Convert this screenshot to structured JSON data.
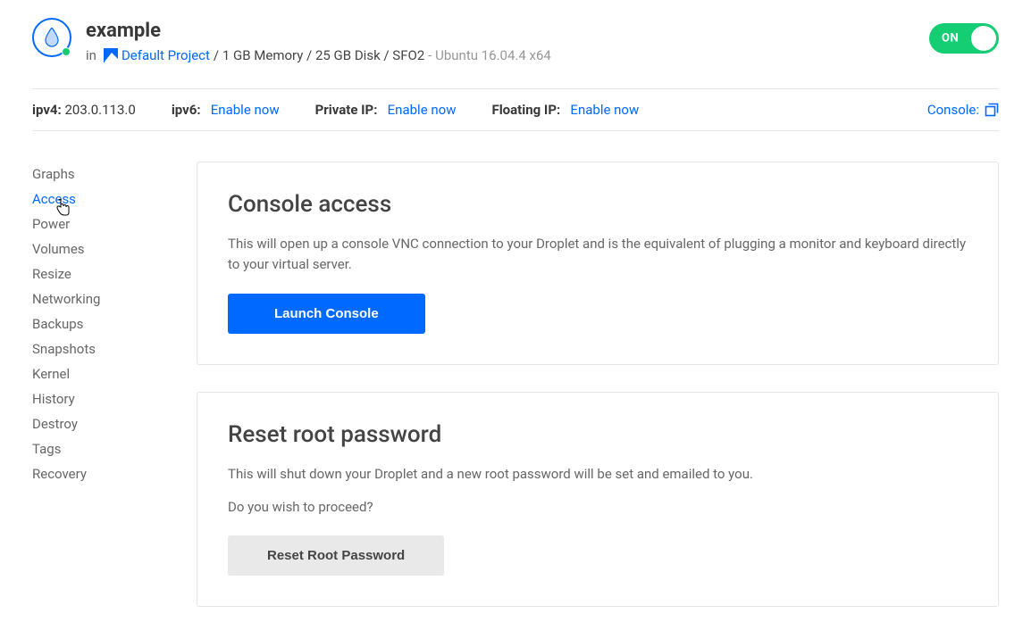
{
  "header": {
    "title": "example",
    "in_text": "in",
    "project_link": "Default Project",
    "specs": " / 1 GB Memory / 25 GB Disk / SFO2",
    "os": " - Ubuntu 16.04.4 x64",
    "toggle_label": "ON"
  },
  "infobar": {
    "ipv4_label": "ipv4:",
    "ipv4_value": "203.0.113.0",
    "ipv6_label": "ipv6:",
    "ipv6_link": "Enable now",
    "private_label": "Private IP:",
    "private_link": "Enable now",
    "floating_label": "Floating IP:",
    "floating_link": "Enable now",
    "console_label": "Console:"
  },
  "sidebar": {
    "items": [
      "Graphs",
      "Access",
      "Power",
      "Volumes",
      "Resize",
      "Networking",
      "Backups",
      "Snapshots",
      "Kernel",
      "History",
      "Destroy",
      "Tags",
      "Recovery"
    ],
    "active_index": 1
  },
  "console_card": {
    "title": "Console access",
    "desc": "This will open up a console VNC connection to your Droplet and is the equivalent of plugging a monitor and keyboard directly to your virtual server.",
    "button": "Launch Console"
  },
  "reset_card": {
    "title": "Reset root password",
    "desc1": "This will shut down your Droplet and a new root password will be set and emailed to you.",
    "desc2": "Do you wish to proceed?",
    "button": "Reset Root Password"
  }
}
